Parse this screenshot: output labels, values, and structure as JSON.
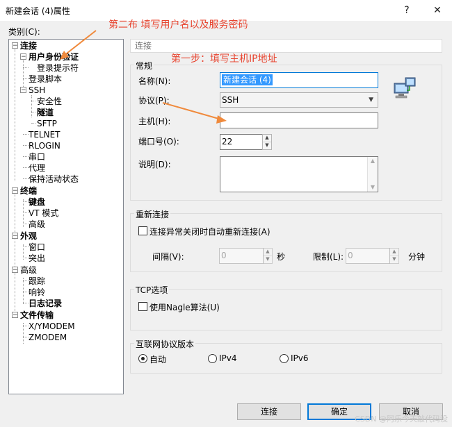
{
  "window": {
    "title": "新建会话 (4)属性",
    "help": "?",
    "close": "✕"
  },
  "category": {
    "label": "类别(C):",
    "items": [
      "连接",
      "用户身份验证",
      "登录提示符",
      "登录脚本",
      "SSH",
      "安全性",
      "隧道",
      "SFTP",
      "TELNET",
      "RLOGIN",
      "串口",
      "代理",
      "保持活动状态",
      "终端",
      "键盘",
      "VT 模式",
      "高级",
      "外观",
      "窗口",
      "突出",
      "高级",
      "跟踪",
      "响铃",
      "日志记录",
      "文件传输",
      "X/YMODEM",
      "ZMODEM"
    ]
  },
  "section_title": "连接",
  "general": {
    "title": "常规",
    "name_label": "名称(N):",
    "name_value": "新建会话 (4)",
    "protocol_label": "协议(P):",
    "protocol_value": "SSH",
    "host_label": "主机(H):",
    "host_value": "",
    "port_label": "端口号(O):",
    "port_value": "22",
    "desc_label": "说明(D):",
    "desc_value": ""
  },
  "reconnect": {
    "title": "重新连接",
    "checkbox_label": "连接异常关闭时自动重新连接(A)",
    "interval_label": "间隔(V):",
    "interval_value": "0",
    "interval_unit": "秒",
    "limit_label": "限制(L):",
    "limit_value": "0",
    "limit_unit": "分钟"
  },
  "tcp": {
    "title": "TCP选项",
    "nagle_label": "使用Nagle算法(U)"
  },
  "ipver": {
    "title": "互联网协议版本",
    "auto": "自动",
    "ipv4": "IPv4",
    "ipv6": "IPv6",
    "selected": "auto"
  },
  "buttons": {
    "connect": "连接",
    "ok": "确定",
    "cancel": "取消"
  },
  "annotations": {
    "step1": "第一步：填写主机IP地址",
    "step2": "第二布 填写用户名以及服务密码"
  },
  "watermark": "CSDN @阿乐今天敲代码没",
  "colors": {
    "annotation": "#e8442f",
    "selection": "#3399ff",
    "default_button": "#0078d7"
  }
}
